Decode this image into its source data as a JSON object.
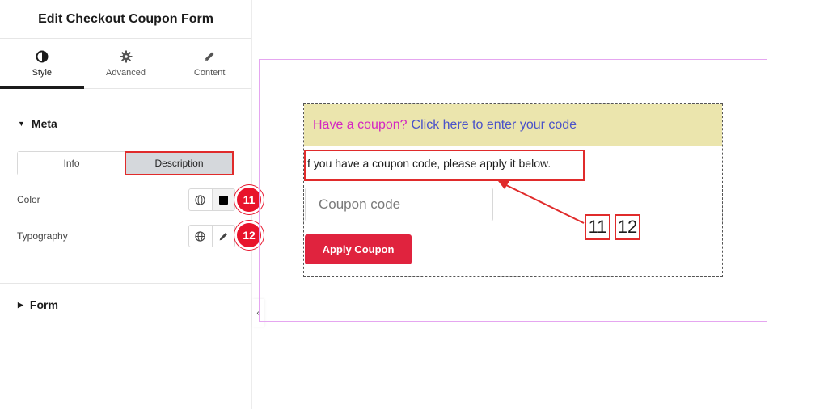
{
  "panel": {
    "title": "Edit Checkout Coupon Form",
    "tabs": [
      {
        "label": "Style",
        "icon": "contrast-icon"
      },
      {
        "label": "Advanced",
        "icon": "gear-icon"
      },
      {
        "label": "Content",
        "icon": "pencil-icon"
      }
    ],
    "sections": {
      "meta": "Meta",
      "form": "Form"
    },
    "segment": {
      "info": "Info",
      "description": "Description"
    },
    "controls": {
      "color_label": "Color",
      "typography_label": "Typography",
      "color_value": "#000000"
    },
    "badges": {
      "color": "11",
      "typography": "12"
    }
  },
  "preview": {
    "have_coupon": "Have a coupon?",
    "click_here": "Click here to enter your code",
    "description": "f you have a coupon code, please apply it below.",
    "coupon_placeholder": "Coupon code",
    "apply_button": "Apply Coupon",
    "callouts": [
      "11",
      "12"
    ]
  },
  "colors": {
    "accent_red": "#e0233e",
    "banner_bg": "#ebe5ad",
    "have_coupon_text": "#d426c2",
    "link_text": "#4a52c9",
    "preview_border": "#e5a6f0"
  }
}
